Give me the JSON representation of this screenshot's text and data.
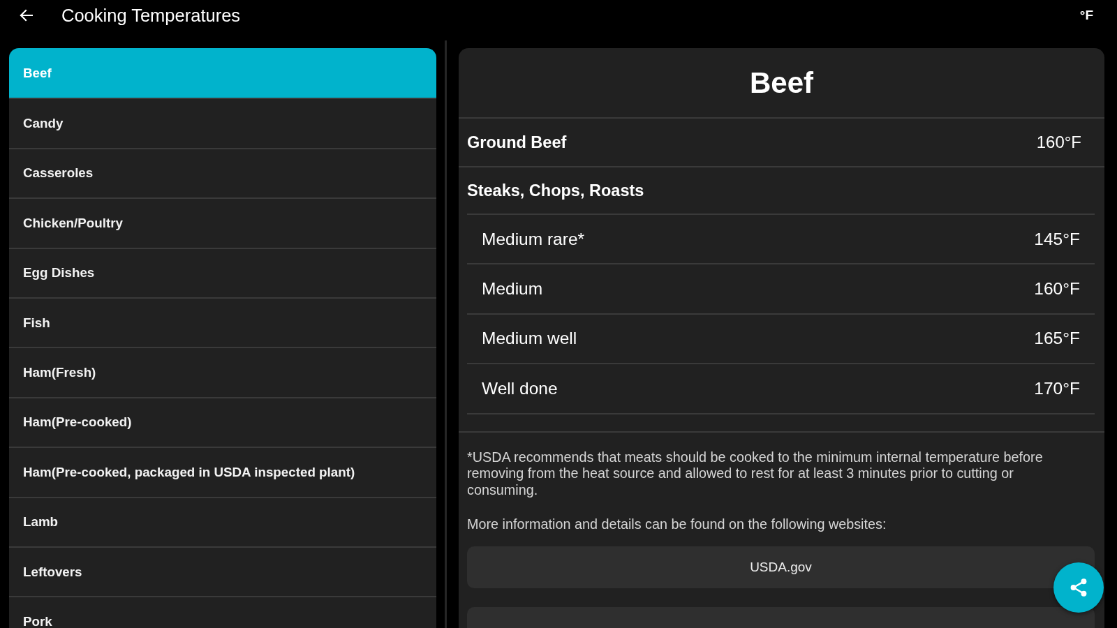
{
  "app_bar": {
    "title": "Cooking Temperatures",
    "unit_toggle": "°F"
  },
  "categories": [
    {
      "label": "Beef",
      "selected": true
    },
    {
      "label": "Candy",
      "selected": false
    },
    {
      "label": "Casseroles",
      "selected": false
    },
    {
      "label": "Chicken/Poultry",
      "selected": false
    },
    {
      "label": "Egg Dishes",
      "selected": false
    },
    {
      "label": "Fish",
      "selected": false
    },
    {
      "label": "Ham(Fresh)",
      "selected": false
    },
    {
      "label": "Ham(Pre-cooked)",
      "selected": false
    },
    {
      "label": "Ham(Pre-cooked, packaged in USDA inspected plant)",
      "selected": false
    },
    {
      "label": "Lamb",
      "selected": false
    },
    {
      "label": "Leftovers",
      "selected": false
    },
    {
      "label": "Pork",
      "selected": false
    }
  ],
  "detail": {
    "title": "Beef",
    "rows": [
      {
        "kind": "item",
        "label": "Ground Beef",
        "value": "160°F"
      },
      {
        "kind": "group",
        "label": "Steaks, Chops, Roasts",
        "children": [
          {
            "label": "Medium rare*",
            "value": "145°F"
          },
          {
            "label": "Medium",
            "value": "160°F"
          },
          {
            "label": "Medium well",
            "value": "165°F"
          },
          {
            "label": "Well done",
            "value": "170°F"
          }
        ]
      }
    ],
    "footnote": "*USDA recommends that meats should be cooked to the minimum internal temperature before removing from the heat source and allowed to rest for at least 3 minutes prior to cutting or consuming.",
    "more_info": "More information and details can be found on the following websites:",
    "links": [
      {
        "label": "USDA.gov"
      }
    ],
    "partial_link": true
  }
}
